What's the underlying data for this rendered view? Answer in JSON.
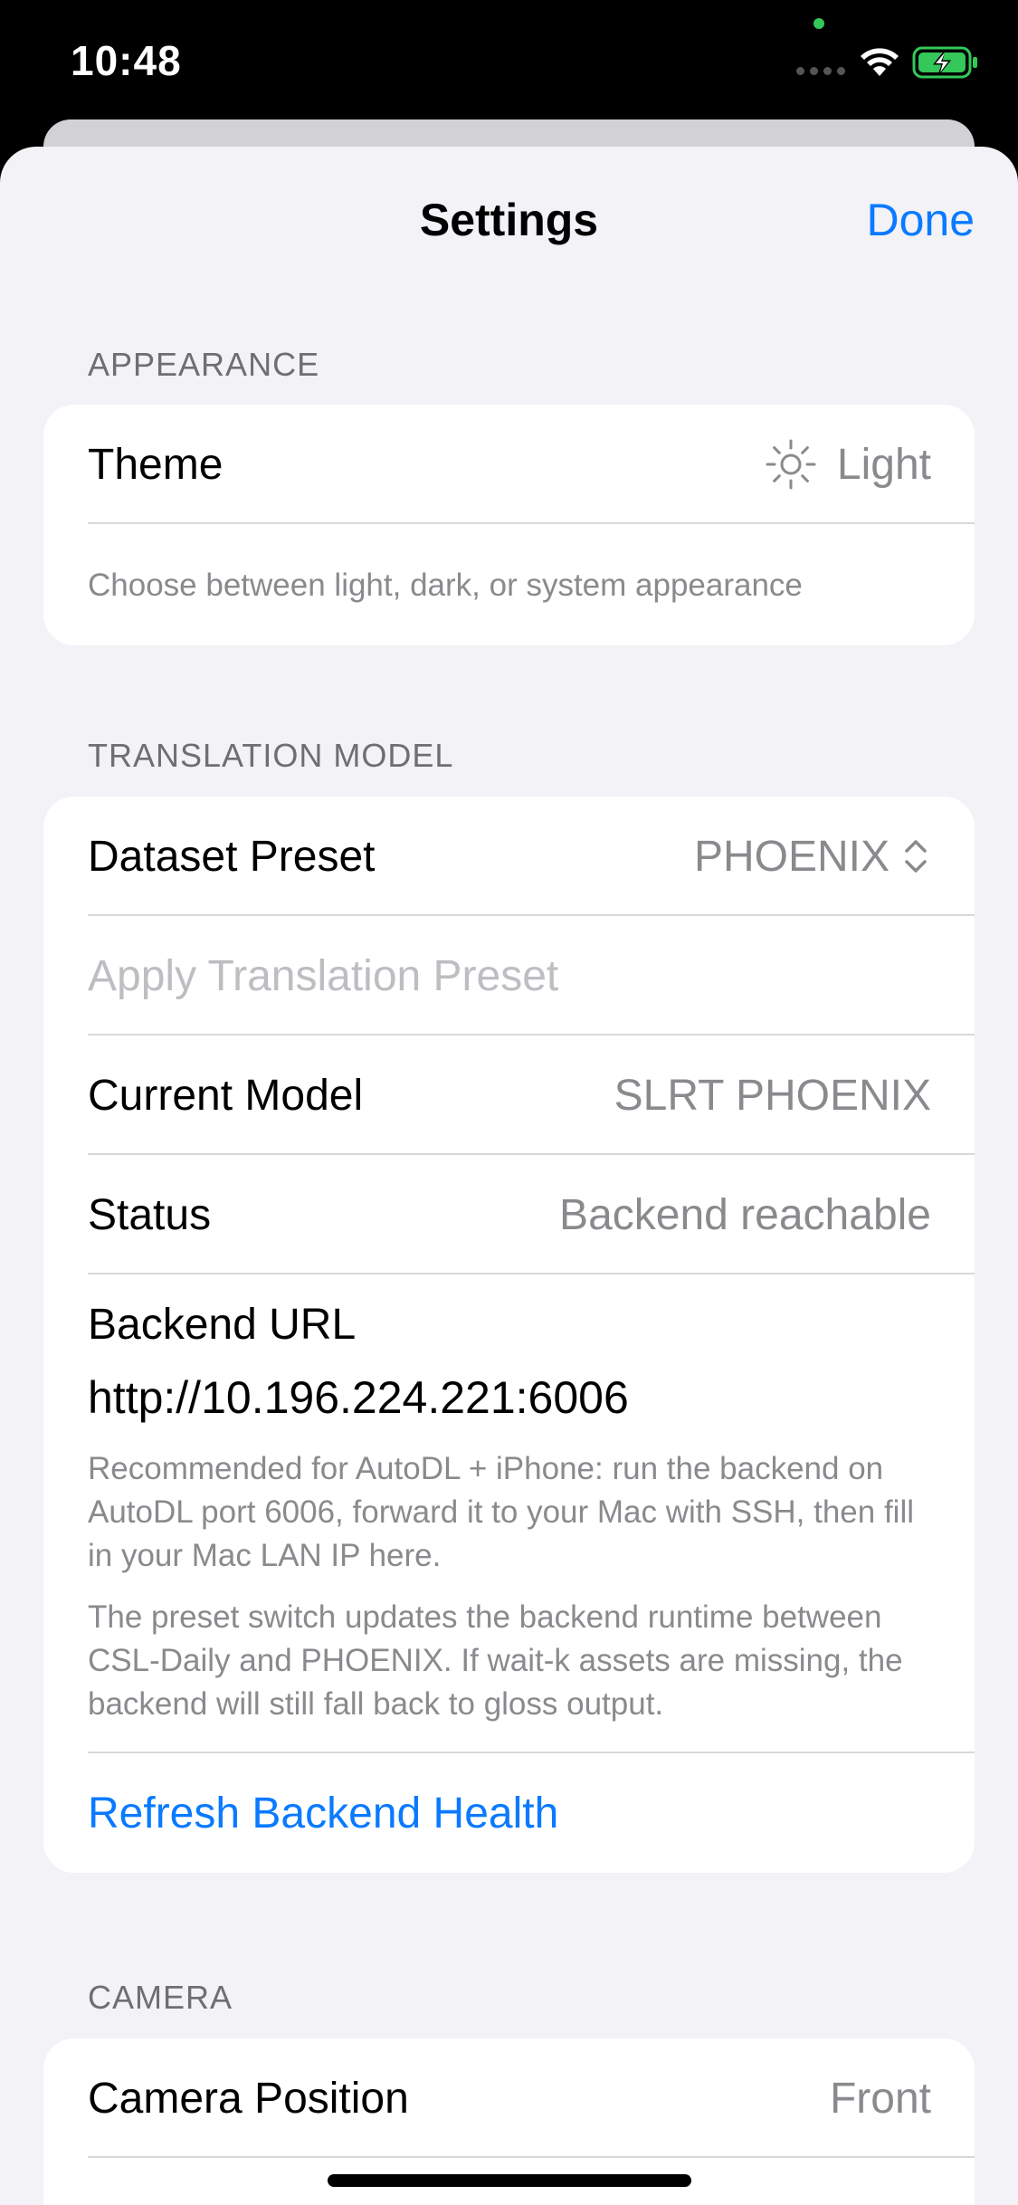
{
  "status_bar": {
    "time": "10:48"
  },
  "nav": {
    "title": "Settings",
    "done_label": "Done"
  },
  "appearance": {
    "header": "APPEARANCE",
    "theme_label": "Theme",
    "theme_icon": "sun-icon",
    "theme_value": "Light",
    "footnote": "Choose between light, dark, or system appearance"
  },
  "translation_model": {
    "header": "TRANSLATION MODEL",
    "dataset_preset_label": "Dataset Preset",
    "dataset_preset_value": "PHOENIX",
    "apply_preset_label": "Apply Translation Preset",
    "current_model_label": "Current Model",
    "current_model_value": "SLRT PHOENIX",
    "status_label": "Status",
    "status_value": "Backend reachable",
    "backend_url_label": "Backend URL",
    "backend_url_value": "http://10.196.224.221:6006",
    "note_1": "Recommended for AutoDL + iPhone: run the backend on AutoDL port 6006, forward it to your Mac with SSH, then fill in your Mac LAN IP here.",
    "note_2": "The preset switch updates the backend runtime between CSL-Daily and PHOENIX. If wait-k assets are missing, the backend will still fall back to gloss output.",
    "refresh_label": "Refresh Backend Health"
  },
  "camera": {
    "header": "CAMERA",
    "position_label": "Camera Position",
    "position_value": "Front"
  },
  "colors": {
    "accent": "#0a7aff",
    "background": "#f2f2f7",
    "secondary_text": "#8a8a8e"
  }
}
